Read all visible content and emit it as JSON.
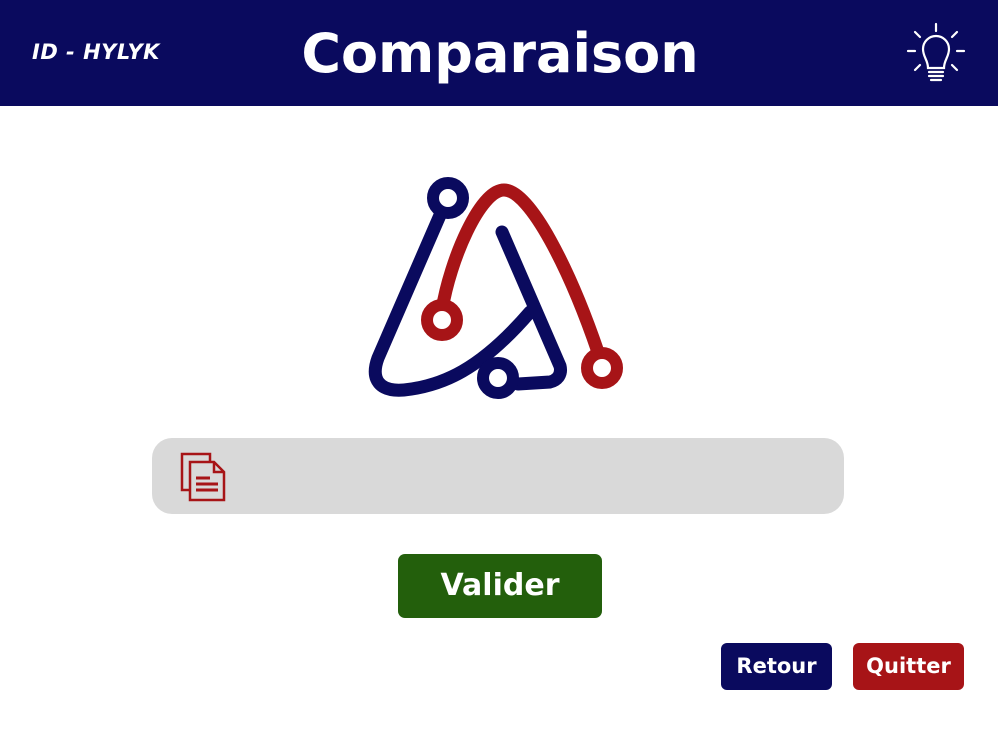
{
  "header": {
    "id_label": "ID - HYLYK",
    "title": "Comparaison",
    "hint_icon": "lightbulb-icon"
  },
  "logo": {
    "name": "brand-logo"
  },
  "file_field": {
    "icon": "document-icon",
    "value": ""
  },
  "buttons": {
    "validate": "Valider",
    "back": "Retour",
    "quit": "Quitter"
  },
  "colors": {
    "navy": "#0a0a5e",
    "red": "#a71417",
    "green": "#235f0c",
    "field": "#d9d9d9"
  }
}
